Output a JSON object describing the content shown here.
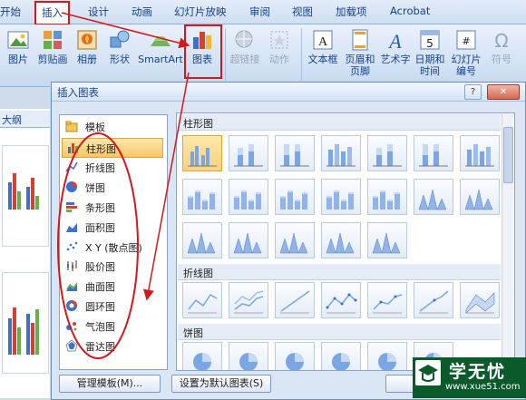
{
  "ribbon_tabs": [
    "开始",
    "插入",
    "设计",
    "动画",
    "幻灯片放映",
    "审阅",
    "视图",
    "加载项",
    "Acrobat"
  ],
  "ribbon_buttons": {
    "picture": "图片",
    "clipart": "剪贴画",
    "album": "相册",
    "shapes": "形状",
    "smartart": "SmartArt",
    "chart": "图表",
    "hyperlink": "超链接",
    "action": "动作",
    "textbox": "文本框",
    "header_footer_1": "页眉和",
    "header_footer_2": "页脚",
    "wordart": "艺术字",
    "datetime_1": "日期和",
    "datetime_2": "时间",
    "slide_number_1": "幻灯片",
    "slide_number_2": "编号",
    "symbol": "符号"
  },
  "date_icon_number": "5",
  "left_pane": {
    "outline_tab": "大纲"
  },
  "dialog": {
    "title": "插入图表",
    "help": "?",
    "close": "✕",
    "chart_types": [
      {
        "label": "模板",
        "icon": "folder-icon"
      },
      {
        "label": "柱形图",
        "icon": "column-chart-icon"
      },
      {
        "label": "折线图",
        "icon": "line-chart-icon"
      },
      {
        "label": "饼图",
        "icon": "pie-chart-icon"
      },
      {
        "label": "条形图",
        "icon": "bar-chart-icon"
      },
      {
        "label": "面积图",
        "icon": "area-chart-icon"
      },
      {
        "label": "X Y (散点图)",
        "icon": "scatter-chart-icon"
      },
      {
        "label": "股价图",
        "icon": "stock-chart-icon"
      },
      {
        "label": "曲面图",
        "icon": "surface-chart-icon"
      },
      {
        "label": "圆环图",
        "icon": "doughnut-chart-icon"
      },
      {
        "label": "气泡图",
        "icon": "bubble-chart-icon"
      },
      {
        "label": "雷达图",
        "icon": "radar-chart-icon"
      }
    ],
    "selected_type_index": 1,
    "gallery_sections": [
      "柱形图",
      "折线图",
      "饼图"
    ],
    "manage_templates": "管理模板(M)...",
    "set_default": "设置为默认图表(S)",
    "ok_partial": "确"
  },
  "watermark": {
    "title": "学无忧",
    "url": "www.xue51.com"
  },
  "colors": {
    "annotation_red": "#d8151b",
    "selection_orange": "#f8c66a",
    "ribbon_blue": "#15428b"
  }
}
